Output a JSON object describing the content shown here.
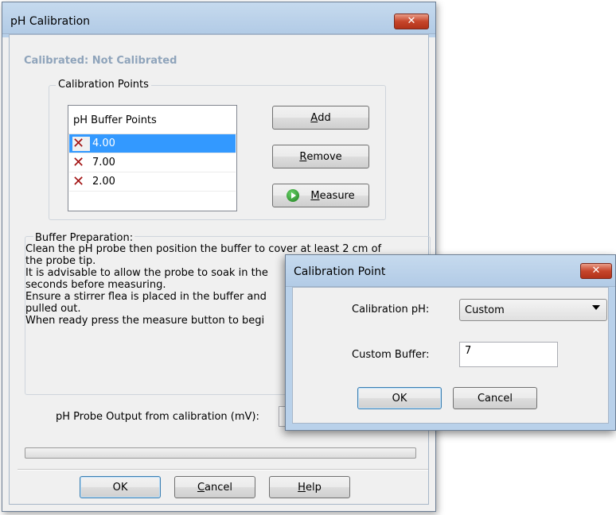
{
  "main_dialog": {
    "title": "pH Calibration",
    "close_label": "✕",
    "status": "Calibrated: Not Calibrated",
    "calibration_points_label": "Calibration Points",
    "list_header": "pH Buffer Points",
    "points": [
      "4.00",
      "7.00",
      "2.00"
    ],
    "selected_index": 0,
    "buttons": {
      "add": {
        "pre": "",
        "key": "A",
        "post": "dd"
      },
      "remove": {
        "pre": "",
        "key": "R",
        "post": "emove"
      },
      "measure": {
        "pre": "",
        "key": "M",
        "post": "easure"
      }
    },
    "buffer_prep_label": "Buffer Preparation:",
    "buffer_prep_lines": [
      "Clean the pH probe then position the buffer to cover at least 2 cm of",
      "the probe tip.",
      "It is advisable to allow the probe to soak in the",
      "seconds before measuring.",
      "Ensure a stirrer flea is placed in the buffer and",
      "pulled out.",
      "When ready press the measure button to begi"
    ],
    "probe_output_label": "pH Probe Output from calibration (mV):",
    "probe_output_value": "",
    "progress": 0,
    "footer": {
      "ok": "OK",
      "cancel": {
        "pre": "",
        "key": "C",
        "post": "ancel"
      },
      "help": {
        "pre": "",
        "key": "H",
        "post": "elp"
      }
    }
  },
  "point_dialog": {
    "title": "Calibration Point",
    "close_label": "✕",
    "calibration_ph_label": "Calibration pH:",
    "calibration_ph_value": "Custom",
    "custom_buffer_label": "Custom Buffer:",
    "custom_buffer_value": "7",
    "ok": "OK",
    "cancel": "Cancel"
  }
}
